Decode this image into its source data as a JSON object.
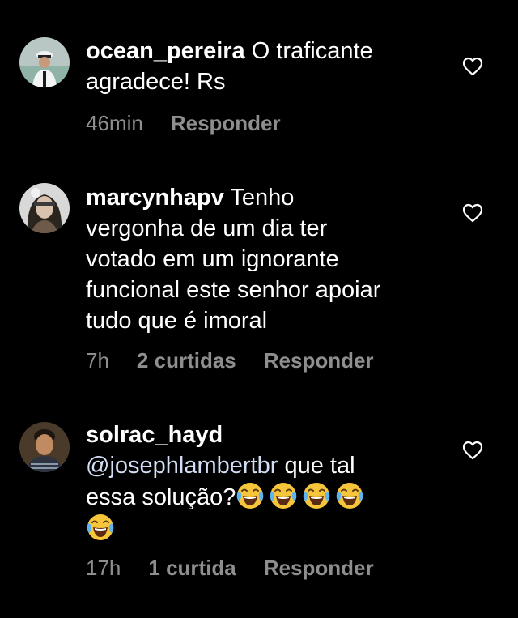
{
  "comments": [
    {
      "username": "ocean_pereira",
      "text_lines": [
        "O traficante",
        "agradece!  Rs"
      ],
      "time": "46min",
      "likes": "",
      "reply_label": "Responder",
      "avatar": "avatar-captain"
    },
    {
      "username": "marcynhapv",
      "text_lines": [
        "Tenho",
        "vergonha de um dia ter",
        "votado em um ignorante",
        "funcional este senhor apoiar",
        "tudo que é imoral"
      ],
      "time": "7h",
      "likes": "2 curtidas",
      "reply_label": "Responder",
      "avatar": "avatar-woman"
    },
    {
      "username": "solrac_hayd",
      "mention": "@josephlambertbr",
      "text_lines": [
        "que tal",
        "essa solução?"
      ],
      "emoji": "face-with-tears-of-joy",
      "emoji_count_line1": 4,
      "emoji_count_line2": 1,
      "time": "17h",
      "likes": "1 curtida",
      "reply_label": "Responder",
      "avatar": "avatar-man"
    }
  ],
  "colors": {
    "background": "#000000",
    "text": "#ffffff",
    "meta": "#8e8e8e",
    "mention": "#d2def4"
  },
  "icons": {
    "like": "heart-outline-icon"
  }
}
